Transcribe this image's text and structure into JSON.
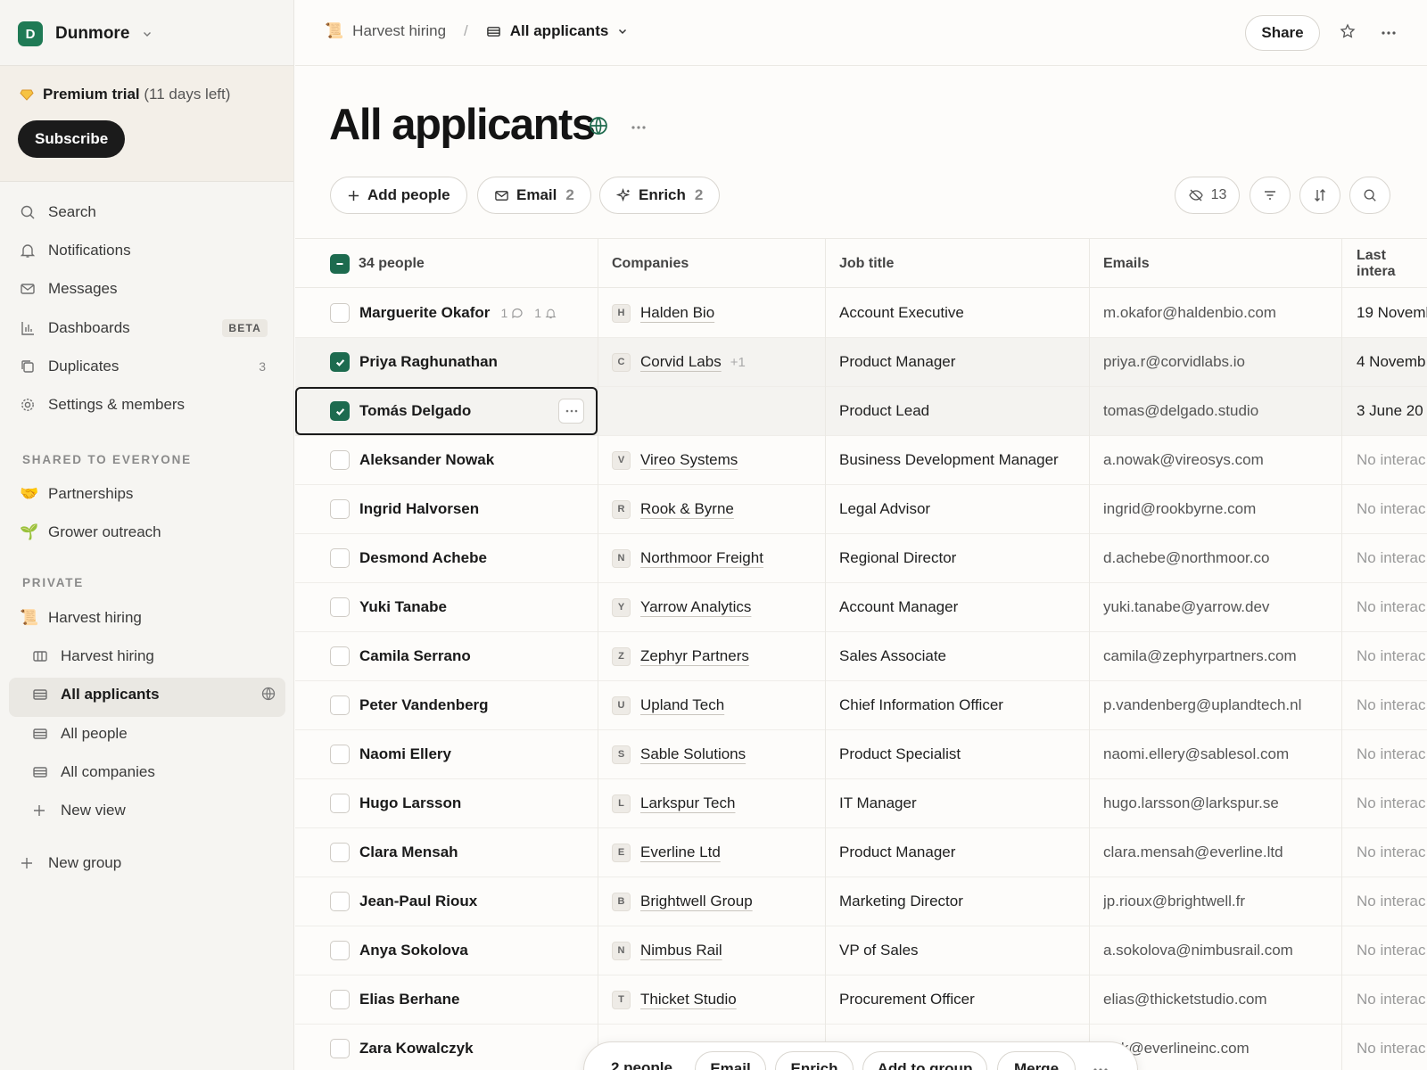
{
  "workspace": {
    "initial": "D",
    "name": "Dunmore"
  },
  "trial": {
    "title": "Premium trial",
    "days": "(11 days left)",
    "subscribe": "Subscribe"
  },
  "nav": {
    "search": "Search",
    "notifications": "Notifications",
    "messages": "Messages",
    "dashboards": "Dashboards",
    "dashboards_badge": "BETA",
    "duplicates": "Duplicates",
    "duplicates_count": "3",
    "settings": "Settings & members"
  },
  "shared": {
    "heading": "SHARED TO EVERYONE",
    "items": [
      {
        "label": "Partnerships",
        "icon": "🤝"
      },
      {
        "label": "Grower outreach",
        "icon": "🌱"
      }
    ]
  },
  "private": {
    "heading": "PRIVATE",
    "group": {
      "label": "Harvest hiring",
      "icon": "📜"
    },
    "views": [
      "Harvest hiring",
      "All applicants",
      "All people",
      "All companies"
    ],
    "new_view": "New view",
    "new_group": "New group"
  },
  "breadcrumb": {
    "parent": "Harvest hiring",
    "parent_icon": "📜",
    "current": "All applicants"
  },
  "header": {
    "share": "Share"
  },
  "page": {
    "title": "All applicants"
  },
  "toolbar": {
    "add_people": "Add people",
    "email": "Email",
    "email_count": "2",
    "enrich": "Enrich",
    "enrich_count": "2",
    "hidden_count": "13"
  },
  "table": {
    "count_label": "34 people",
    "columns": [
      "Companies",
      "Job title",
      "Emails",
      "Last intera"
    ],
    "rows": [
      {
        "name": "Marguerite Okafor",
        "comments": "1",
        "reminders": "1",
        "badge": "H",
        "company": "Halden Bio",
        "extra": "",
        "title": "Account Executive",
        "email": "m.okafor@haldenbio.com",
        "last": "19 Novemb",
        "checked": false
      },
      {
        "name": "Priya Raghunathan",
        "comments": "",
        "reminders": "",
        "badge": "C",
        "company": "Corvid Labs",
        "extra": "+1",
        "title": "Product Manager",
        "email": "priya.r@corvidlabs.io",
        "last": "4 Novemb",
        "checked": true
      },
      {
        "name": "Tomás Delgado",
        "comments": "",
        "reminders": "",
        "badge": "",
        "company": "",
        "extra": "",
        "title": "Product Lead",
        "email": "tomas@delgado.studio",
        "last": "3 June 20",
        "checked": true
      },
      {
        "name": "Aleksander Nowak",
        "comments": "",
        "reminders": "",
        "badge": "V",
        "company": "Vireo Systems",
        "extra": "",
        "title": "Business Development Manager",
        "email": "a.nowak@vireosys.com",
        "last": "No interac",
        "checked": false
      },
      {
        "name": "Ingrid Halvorsen",
        "comments": "",
        "reminders": "",
        "badge": "R",
        "company": "Rook & Byrne",
        "extra": "",
        "title": "Legal Advisor",
        "email": "ingrid@rookbyrne.com",
        "last": "No interac",
        "checked": false
      },
      {
        "name": "Desmond Achebe",
        "comments": "",
        "reminders": "",
        "badge": "N",
        "company": "Northmoor Freight",
        "extra": "",
        "title": "Regional Director",
        "email": "d.achebe@northmoor.co",
        "last": "No interac",
        "checked": false
      },
      {
        "name": "Yuki Tanabe",
        "comments": "",
        "reminders": "",
        "badge": "Y",
        "company": "Yarrow Analytics",
        "extra": "",
        "title": "Account Manager",
        "email": "yuki.tanabe@yarrow.dev",
        "last": "No interac",
        "checked": false
      },
      {
        "name": "Camila Serrano",
        "comments": "",
        "reminders": "",
        "badge": "Z",
        "company": "Zephyr Partners",
        "extra": "",
        "title": "Sales Associate",
        "email": "camila@zephyrpartners.com",
        "last": "No interac",
        "checked": false
      },
      {
        "name": "Peter Vandenberg",
        "comments": "",
        "reminders": "",
        "badge": "U",
        "company": "Upland Tech",
        "extra": "",
        "title": "Chief Information Officer",
        "email": "p.vandenberg@uplandtech.nl",
        "last": "No interac",
        "checked": false
      },
      {
        "name": "Naomi Ellery",
        "comments": "",
        "reminders": "",
        "badge": "S",
        "company": "Sable Solutions",
        "extra": "",
        "title": "Product Specialist",
        "email": "naomi.ellery@sablesol.com",
        "last": "No interac",
        "checked": false
      },
      {
        "name": "Hugo Larsson",
        "comments": "",
        "reminders": "",
        "badge": "L",
        "company": "Larkspur Tech",
        "extra": "",
        "title": "IT Manager",
        "email": "hugo.larsson@larkspur.se",
        "last": "No interac",
        "checked": false
      },
      {
        "name": "Clara Mensah",
        "comments": "",
        "reminders": "",
        "badge": "E",
        "company": "Everline Ltd",
        "extra": "",
        "title": "Product Manager",
        "email": "clara.mensah@everline.ltd",
        "last": "No interac",
        "checked": false
      },
      {
        "name": "Jean-Paul Rioux",
        "comments": "",
        "reminders": "",
        "badge": "B",
        "company": "Brightwell Group",
        "extra": "",
        "title": "Marketing Director",
        "email": "jp.rioux@brightwell.fr",
        "last": "No interac",
        "checked": false
      },
      {
        "name": "Anya Sokolova",
        "comments": "",
        "reminders": "",
        "badge": "N",
        "company": "Nimbus Rail",
        "extra": "",
        "title": "VP of Sales",
        "email": "a.sokolova@nimbusrail.com",
        "last": "No interac",
        "checked": false
      },
      {
        "name": "Elias Berhane",
        "comments": "",
        "reminders": "",
        "badge": "T",
        "company": "Thicket Studio",
        "extra": "",
        "title": "Procurement Officer",
        "email": "elias@thicketstudio.com",
        "last": "No interac",
        "checked": false
      },
      {
        "name": "Zara Kowalczyk",
        "comments": "",
        "reminders": "",
        "badge": "",
        "company": "",
        "extra": "",
        "title": "",
        "email": "ra.k@everlineinc.com",
        "last": "No interac",
        "checked": false
      }
    ]
  },
  "action_bar": {
    "count": "2 people",
    "email": "Email",
    "enrich": "Enrich",
    "add_to_group": "Add to group",
    "merge": "Merge"
  },
  "colors": {
    "brand": "#1f7a55",
    "checkbox": "#1d6b4f",
    "trial_bg": "#f3efe8"
  }
}
